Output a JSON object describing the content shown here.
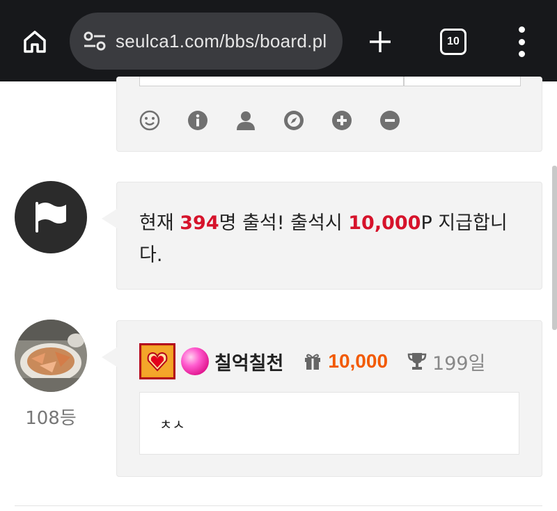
{
  "browser": {
    "url": "seulca1.com/bbs/board.pl",
    "tab_count": "10",
    "icons": {
      "home": "home-icon",
      "site_info": "tune-icon",
      "new_tab": "plus-icon",
      "tabs": "tab-switcher-icon",
      "menu": "more-vert-icon"
    }
  },
  "editor": {
    "tools": [
      "smile-icon",
      "info-icon",
      "user-icon",
      "compass-icon",
      "plus-circle-icon",
      "minus-circle-icon"
    ]
  },
  "attendance": {
    "prefix": "현재 ",
    "count": "394",
    "middle": "명 출석! 출석시 ",
    "points": "10,000",
    "suffix": "P 지급합니다."
  },
  "comment": {
    "rank": "108등",
    "nickname": "칠억칠천",
    "points": "10,000",
    "days": "199일",
    "body": "ㅊㅅ"
  },
  "colors": {
    "topbar": "#17181b",
    "urlbar": "#3a3b3f",
    "highlight_red": "#d6132b",
    "points_orange": "#f25a00",
    "card_bg": "#f3f3f3"
  }
}
